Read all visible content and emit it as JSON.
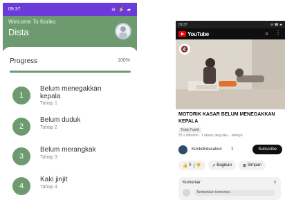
{
  "left_app": {
    "status": {
      "time": "09.37",
      "icons": "⊖ ⚡ ▰"
    },
    "header": {
      "welcome": "Welcome To Koriko",
      "title": "Dista"
    },
    "progress": {
      "label": "Progress",
      "percent_text": "100%",
      "fraction": 1.0
    },
    "steps": [
      {
        "number": "1",
        "title": "Belum menegakkan kepala",
        "subtitle": "Tahap 1"
      },
      {
        "number": "2",
        "title": "Belum duduk",
        "subtitle": "Tahap 2"
      },
      {
        "number": "3",
        "title": "Belum merangkak",
        "subtitle": "Tahap 3"
      },
      {
        "number": "4",
        "title": "Kaki jinjit",
        "subtitle": "Tahap 4"
      }
    ],
    "colors": {
      "status_bar": "#6a3bd9",
      "header": "#6e9a6f",
      "accent": "#6e9a6f"
    }
  },
  "right_app": {
    "status": {
      "time": "09.37",
      "icons": "⊖ ☎ ▰"
    },
    "youtube": {
      "logo": "YouTube",
      "search_icon": "search-icon",
      "more_icon": "more-vert-icon"
    },
    "video": {
      "title": "MOTORIK KASAR BELUM MENEGAKKAN KEPALA",
      "badge": "Tidak Publik",
      "meta": "55 x ditonton · 1 tahun yang lalu  ...lainnya"
    },
    "channel": {
      "name": "KorikoEducation",
      "subs": "3",
      "subscribe": "Subscribe"
    },
    "actions": {
      "like_count": "0",
      "share": "Bagikan",
      "save": "Simpan"
    },
    "comments": {
      "title": "Komentar",
      "placeholder": "Tambahkan komentar..."
    }
  }
}
